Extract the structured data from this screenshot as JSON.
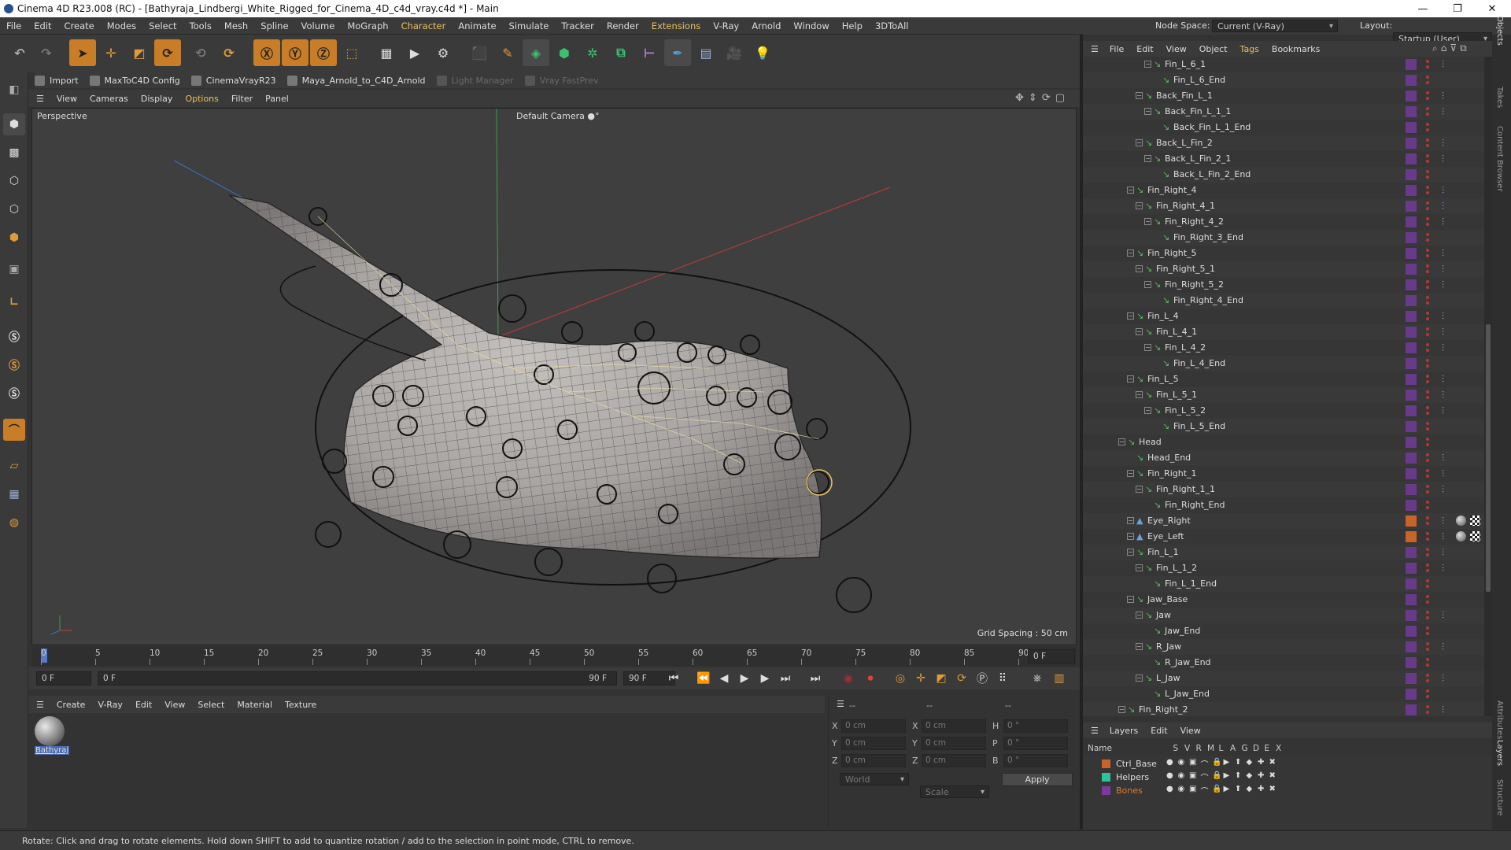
{
  "window": {
    "title": "Cinema 4D R23.008 (RC) - [Bathyraja_Lindbergi_White_Rigged_for_Cinema_4D_c4d_vray.c4d *] - Main",
    "minimize": "—",
    "maximize": "❐",
    "close": "✕"
  },
  "menubar": [
    "File",
    "Edit",
    "Create",
    "Modes",
    "Select",
    "Tools",
    "Mesh",
    "Spline",
    "Volume",
    "MoGraph",
    "Character",
    "Animate",
    "Simulate",
    "Tracker",
    "Render",
    "Extensions",
    "V-Ray",
    "Arnold",
    "Window",
    "Help",
    "3DToAll"
  ],
  "nodespace": {
    "label": "Node Space:",
    "value": "Current (V-Ray)",
    "layout_label": "Layout:",
    "layout_value": "Startup (User)"
  },
  "plugins": [
    {
      "label": "Import",
      "dim": false
    },
    {
      "label": "MaxToC4D Config",
      "dim": false
    },
    {
      "label": "CinemaVrayR23",
      "dim": false
    },
    {
      "label": "Maya_Arnold_to_C4D_Arnold",
      "dim": false
    },
    {
      "label": "Light Manager",
      "dim": true
    },
    {
      "label": "Vray FastPrev",
      "dim": true
    }
  ],
  "viewport_menu": [
    "View",
    "Cameras",
    "Display",
    "Options",
    "Filter",
    "Panel"
  ],
  "viewport": {
    "label": "Perspective",
    "camera": "Default Camera",
    "camera_icon": "camera-icon",
    "grid": "Grid Spacing : 50 cm"
  },
  "timeline": {
    "ticks": [
      "0",
      "5",
      "10",
      "15",
      "20",
      "25",
      "30",
      "35",
      "40",
      "45",
      "50",
      "55",
      "60",
      "65",
      "70",
      "75",
      "80",
      "85",
      "90"
    ],
    "frame_right": "0 F"
  },
  "transport": {
    "start": "0 F",
    "current": "0 F",
    "end": "90 F",
    "end2": "90 F"
  },
  "material_menu": [
    "Create",
    "V-Ray",
    "Edit",
    "View",
    "Select",
    "Material",
    "Texture"
  ],
  "material": {
    "name": "Bathyraj"
  },
  "coords": {
    "header": [
      "--",
      "--",
      "--"
    ],
    "x1": "X",
    "y1": "Y",
    "z1": "Z",
    "x2": "X",
    "y2": "Y",
    "z2": "Z",
    "h": "H",
    "p": "P",
    "b": "B",
    "v": "0 cm",
    "a": "0 °",
    "world": "World",
    "scale": "Scale",
    "apply": "Apply"
  },
  "object_menu": [
    "File",
    "Edit",
    "View",
    "Object",
    "Tags",
    "Bookmarks"
  ],
  "objects": [
    {
      "name": "Fin_L_6_1",
      "indent": 4,
      "tag": true
    },
    {
      "name": "Fin_L_6_End",
      "indent": 5,
      "tag": false
    },
    {
      "name": "Back_Fin_L_1",
      "indent": 3,
      "tag": true
    },
    {
      "name": "Back_Fin_L_1_1",
      "indent": 4,
      "tag": true
    },
    {
      "name": "Back_Fin_L_1_End",
      "indent": 5,
      "tag": false
    },
    {
      "name": "Back_L_Fin_2",
      "indent": 3,
      "tag": true
    },
    {
      "name": "Back_L_Fin_2_1",
      "indent": 4,
      "tag": true
    },
    {
      "name": "Back_L_Fin_2_End",
      "indent": 5,
      "tag": false
    },
    {
      "name": "Fin_Right_4",
      "indent": 2,
      "tag": true
    },
    {
      "name": "Fin_Right_4_1",
      "indent": 3,
      "tag": true
    },
    {
      "name": "Fin_Right_4_2",
      "indent": 4,
      "tag": true
    },
    {
      "name": "Fin_Right_3_End",
      "indent": 5,
      "tag": false
    },
    {
      "name": "Fin_Right_5",
      "indent": 2,
      "tag": true
    },
    {
      "name": "Fin_Right_5_1",
      "indent": 3,
      "tag": true
    },
    {
      "name": "Fin_Right_5_2",
      "indent": 4,
      "tag": true
    },
    {
      "name": "Fin_Right_4_End",
      "indent": 5,
      "tag": false
    },
    {
      "name": "Fin_L_4",
      "indent": 2,
      "tag": true
    },
    {
      "name": "Fin_L_4_1",
      "indent": 3,
      "tag": true
    },
    {
      "name": "Fin_L_4_2",
      "indent": 4,
      "tag": true
    },
    {
      "name": "Fin_L_4_End",
      "indent": 5,
      "tag": false
    },
    {
      "name": "Fin_L_5",
      "indent": 2,
      "tag": true
    },
    {
      "name": "Fin_L_5_1",
      "indent": 3,
      "tag": true
    },
    {
      "name": "Fin_L_5_2",
      "indent": 4,
      "tag": true
    },
    {
      "name": "Fin_L_5_End",
      "indent": 5,
      "tag": false
    },
    {
      "name": "Head",
      "indent": 1,
      "tag": false
    },
    {
      "name": "Head_End",
      "indent": 2,
      "tag": true
    },
    {
      "name": "Fin_Right_1",
      "indent": 2,
      "tag": true
    },
    {
      "name": "Fin_Right_1_1",
      "indent": 3,
      "tag": true
    },
    {
      "name": "Fin_Right_End",
      "indent": 4,
      "tag": false
    },
    {
      "name": "Eye_Right",
      "indent": 2,
      "tag": true,
      "eye": true
    },
    {
      "name": "Eye_Left",
      "indent": 2,
      "tag": true,
      "eye": true
    },
    {
      "name": "Fin_L_1",
      "indent": 2,
      "tag": true
    },
    {
      "name": "Fin_L_1_2",
      "indent": 3,
      "tag": true
    },
    {
      "name": "Fin_L_1_End",
      "indent": 4,
      "tag": false
    },
    {
      "name": "Jaw_Base",
      "indent": 2,
      "tag": false
    },
    {
      "name": "Jaw",
      "indent": 3,
      "tag": true
    },
    {
      "name": "Jaw_End",
      "indent": 4,
      "tag": false
    },
    {
      "name": "R_Jaw",
      "indent": 3,
      "tag": true
    },
    {
      "name": "R_Jaw_End",
      "indent": 4,
      "tag": false
    },
    {
      "name": "L_Jaw",
      "indent": 3,
      "tag": true
    },
    {
      "name": "L_Jaw_End",
      "indent": 4,
      "tag": false
    },
    {
      "name": "Fin_Right_2",
      "indent": 1,
      "tag": true
    }
  ],
  "layers_menu": [
    "Layers",
    "Edit",
    "View"
  ],
  "layer_cols": [
    "Name",
    "S",
    "V",
    "R",
    "M",
    "L",
    "A",
    "G",
    "D",
    "E",
    "X"
  ],
  "layers": [
    {
      "name": "Ctrl_Base",
      "color": "#c8642a",
      "textcolor": "#dddddd"
    },
    {
      "name": "Helpers",
      "color": "#2ec49a",
      "textcolor": "#dddddd"
    },
    {
      "name": "Bones",
      "color": "#7a3aa0",
      "textcolor": "#e07a2a"
    }
  ],
  "sidetabs": [
    "Objects",
    "Takes",
    "Content Browser",
    "Attributes",
    "Layers",
    "Structure"
  ],
  "status": "Rotate: Click and drag to rotate elements. Hold down SHIFT to add to quantize rotation / add to the selection in point mode, CTRL to remove."
}
